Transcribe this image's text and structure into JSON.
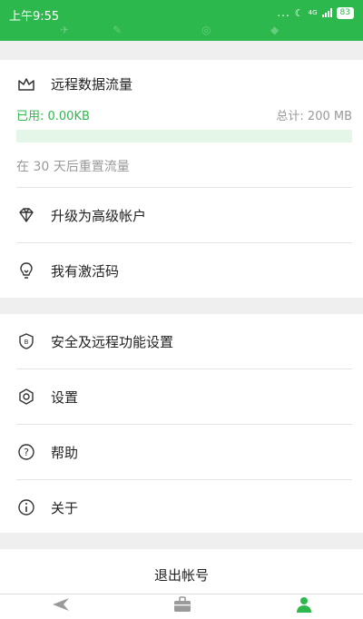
{
  "status_bar": {
    "time": "上午9:55",
    "dots": "...",
    "network": "4G",
    "battery": "83"
  },
  "usage": {
    "title": "远程数据流量",
    "used_label": "已用: 0.00KB",
    "total_label": "总计: 200 MB",
    "used_fraction": 0,
    "reset_text": "在 30 天后重置流量"
  },
  "menu_upgrade": {
    "upgrade_label": "升级为高级帐户",
    "activation_label": "我有激活码"
  },
  "menu_settings": {
    "security_label": "安全及远程功能设置",
    "settings_label": "设置",
    "help_label": "帮助",
    "about_label": "关于"
  },
  "logout_label": "退出帐号",
  "tabs": [
    {
      "icon": "send-icon",
      "active": false
    },
    {
      "icon": "briefcase-icon",
      "active": false
    },
    {
      "icon": "person-icon",
      "active": true
    }
  ],
  "colors": {
    "accent": "#2db84d",
    "inactive_icon": "#9a9a9a"
  }
}
